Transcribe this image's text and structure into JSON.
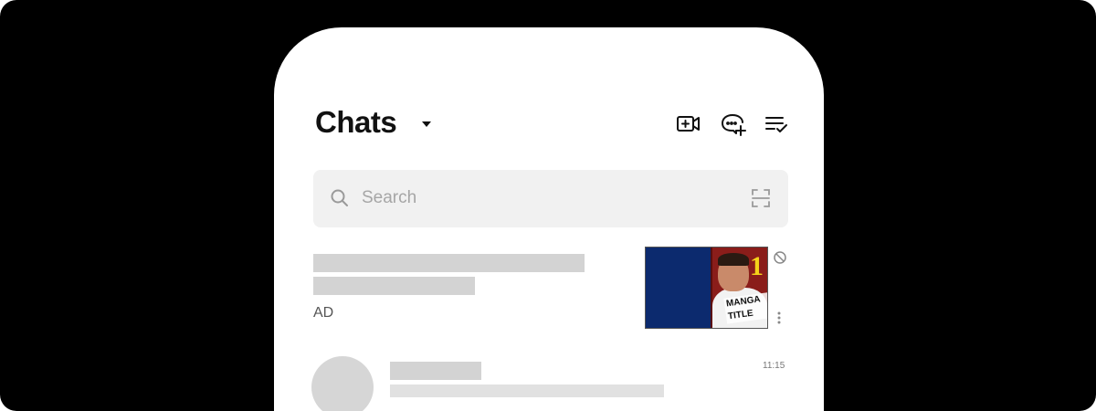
{
  "header": {
    "title": "Chats"
  },
  "header_icons": [
    "video-call-plus-icon",
    "new-chat-icon",
    "edit-list-icon",
    "caret-down-icon"
  ],
  "search": {
    "placeholder": "Search"
  },
  "ad": {
    "label": "AD",
    "banner": {
      "number": "1",
      "caption": "MANGA TITLE",
      "bg_color": "#0c2a6e",
      "cover_color": "#8a1d1a",
      "number_color": "#f5d21a"
    }
  },
  "chats": [
    {
      "time": "11:15"
    }
  ],
  "colors": {
    "frame_bg": "#000000",
    "screen_bg": "#ffffff",
    "search_bg": "#f1f1f1",
    "skeleton": "#d3d3d3"
  }
}
